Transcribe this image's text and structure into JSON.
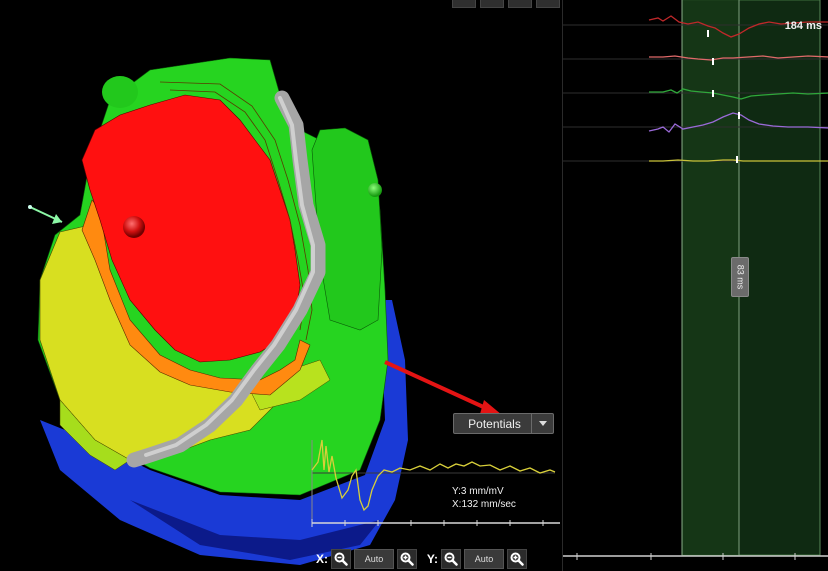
{
  "map_selector": {
    "label": "Potentials"
  },
  "scale": {
    "y_label": "Y:3 mm/mV",
    "x_label": "X:132 mm/sec"
  },
  "zoom_controls": {
    "x_axis_label": "X:",
    "y_axis_label": "Y:",
    "x_auto_label": "Auto",
    "y_auto_label": "Auto"
  },
  "ecg": {
    "duration_label": "184 ms",
    "window_label": "83 ms",
    "channel_colors": [
      "#c0282a",
      "#e06a6a",
      "#2fa83a",
      "#9a6ad8",
      "#c9c23a"
    ]
  },
  "map_colors": {
    "red": "#ff1010",
    "orange": "#ff8a10",
    "yellow": "#d8df20",
    "green": "#26d420",
    "blue": "#1638d8",
    "catheter": "#a6a6a6"
  },
  "icons": {
    "zoom_out": "magnifier-minus-icon",
    "zoom_in": "magnifier-plus-icon",
    "dropdown": "chevron-down-icon"
  }
}
